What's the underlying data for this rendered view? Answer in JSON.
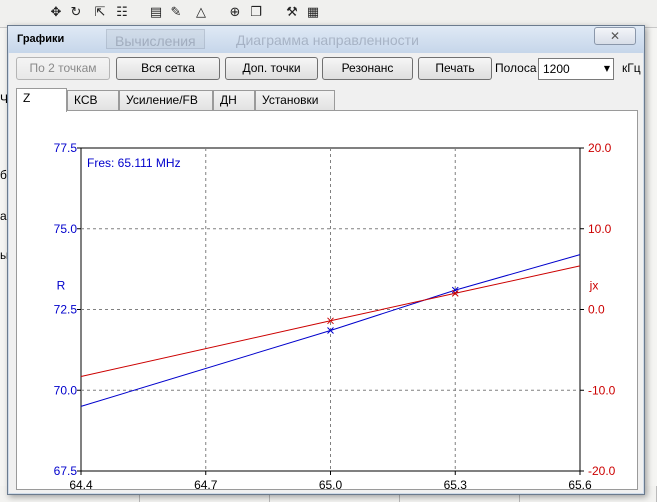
{
  "background_app": {
    "toolbar_icons": [
      "move-icon",
      "rotate-icon",
      "export-icon",
      "grid-icon",
      "document-icon",
      "signature-icon",
      "triangle-icon",
      "crosshair-icon",
      "copy-icon",
      "tools-icon",
      "calculator-icon"
    ],
    "ghost_tabs": [
      "Вычисления",
      "Диаграмма направленности"
    ],
    "left_fragments": [
      "Ча",
      "б",
      "а.",
      "ы"
    ],
    "bottom_cells": [
      "",
      "",
      "",
      "",
      ""
    ]
  },
  "dialog": {
    "title": "Графики",
    "close_label": "✕"
  },
  "toolbar": {
    "btn_two_points": "По 2 точкам",
    "btn_full_grid": "Вся сетка",
    "btn_extra_points": "Доп. точки",
    "btn_resonance": "Резонанс",
    "btn_print": "Печать",
    "band_label": "Полоса",
    "band_value": "1200",
    "band_unit": "кГц"
  },
  "tabs": [
    "Z",
    "КСВ",
    "Усиление/FB",
    "ДН",
    "Установки"
  ],
  "chart_data": {
    "type": "line",
    "annotation": "Fres: 65.111 MHz",
    "xlabel": "",
    "ylabel_left": "R",
    "ylabel_right": "jx",
    "x_ticks": [
      "64.4",
      "64.7",
      "65.0",
      "65.3",
      "65.6"
    ],
    "x_values": [
      64.4,
      64.7,
      65.0,
      65.3,
      65.6
    ],
    "xlim": [
      64.4,
      65.6
    ],
    "y_left_ticks": [
      "77.5",
      "75.0",
      "72.5",
      "70.0",
      "67.5"
    ],
    "y_left_values": [
      77.5,
      75.0,
      72.5,
      70.0,
      67.5
    ],
    "y_left_lim": [
      67.5,
      77.5
    ],
    "y_right_ticks": [
      "20.0",
      "10.0",
      "0.0",
      "-10.0",
      "-20.0"
    ],
    "y_right_values": [
      20.0,
      10.0,
      0.0,
      -10.0,
      -20.0
    ],
    "y_right_lim": [
      -20.0,
      20.0
    ],
    "grid": true,
    "colors": {
      "r_series": "#0000cc",
      "jx_series": "#cc0000",
      "grid": "#808080",
      "annotation": "#0000cc"
    },
    "series": [
      {
        "name": "R",
        "axis": "left",
        "color": "#0000cc",
        "x": [
          64.4,
          65.0,
          65.3,
          65.6
        ],
        "y": [
          69.5,
          71.85,
          73.1,
          74.2
        ],
        "markers_at": [
          65.0,
          65.3
        ]
      },
      {
        "name": "jx",
        "axis": "right",
        "color": "#cc0000",
        "x": [
          64.4,
          65.0,
          65.3,
          65.6
        ],
        "y": [
          -8.3,
          -1.4,
          2.0,
          5.4
        ],
        "markers_at": [
          65.0,
          65.3
        ]
      }
    ]
  }
}
